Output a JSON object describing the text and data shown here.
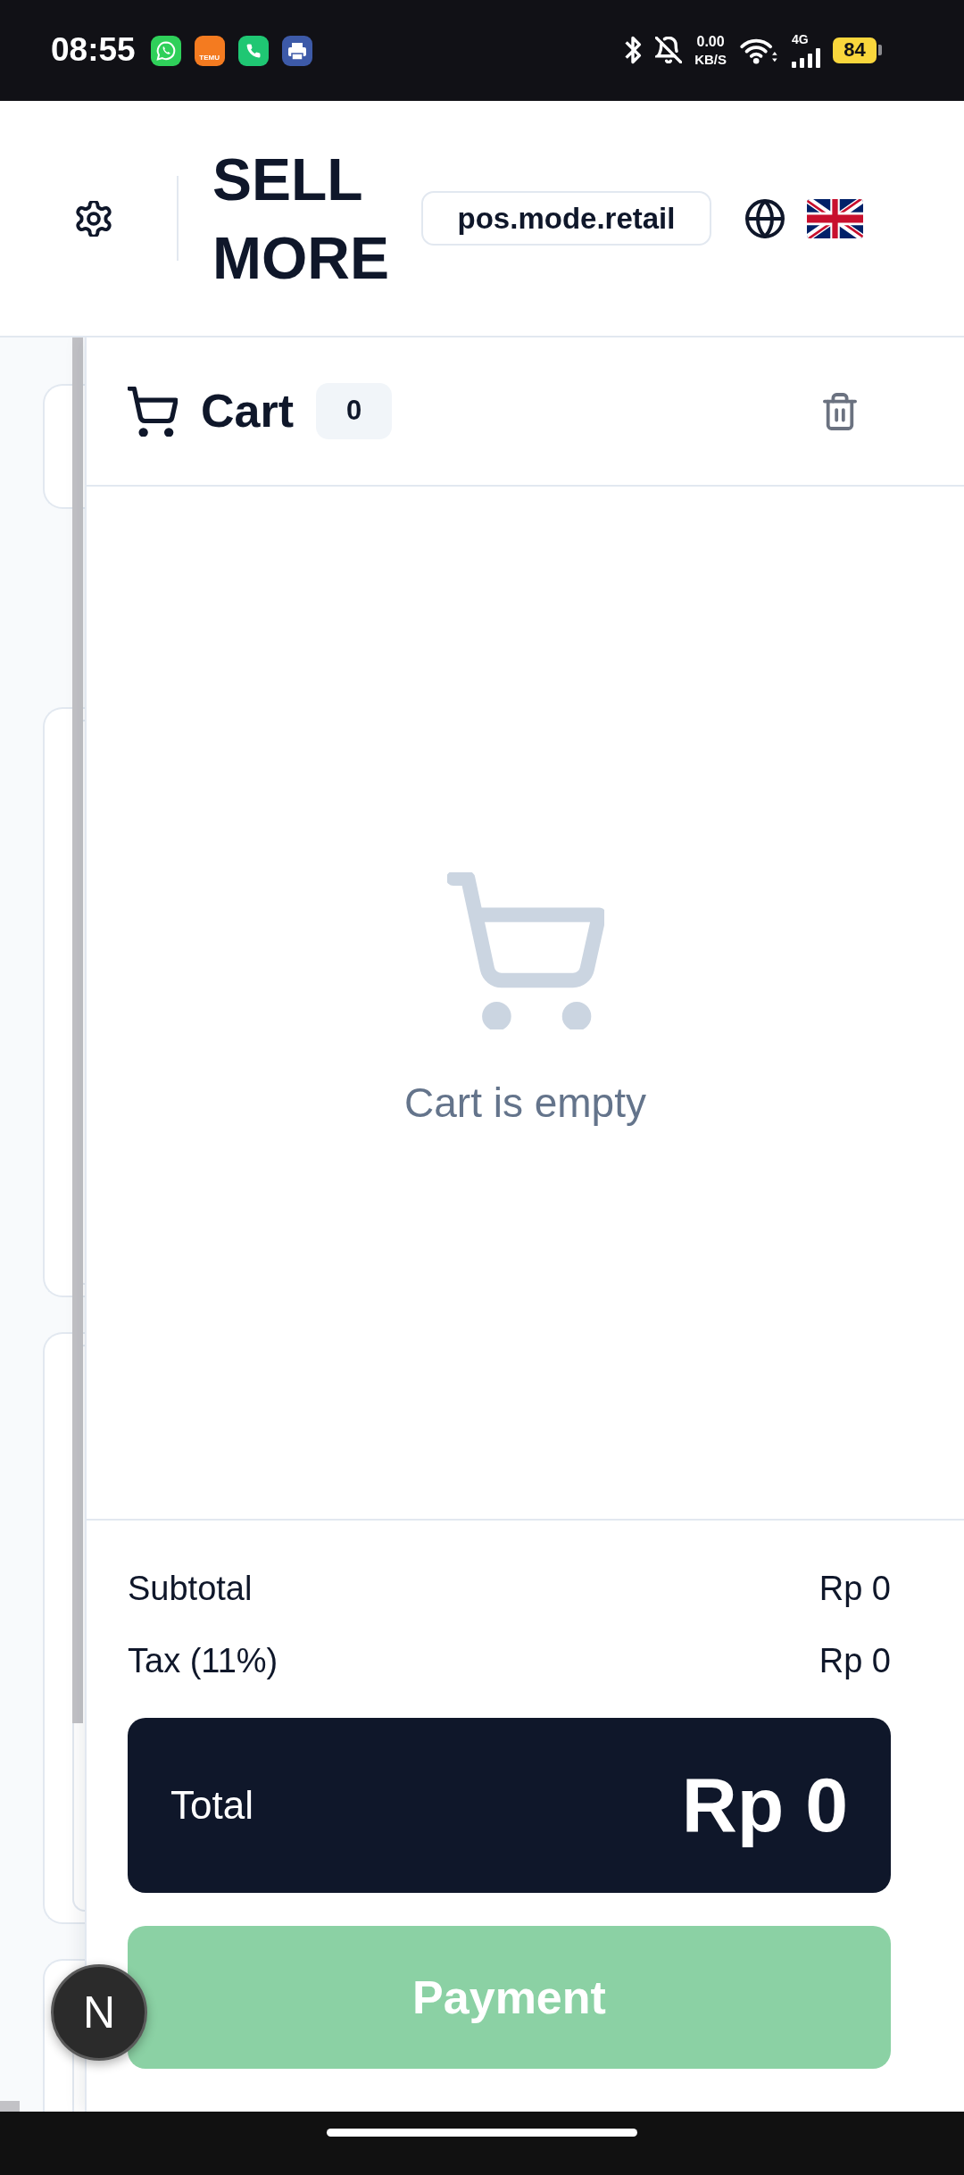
{
  "status_bar": {
    "time": "08:55",
    "notification_app_label": "TEMU",
    "data_speed": "0.00",
    "data_speed_unit": "KB/S",
    "network_type": "4G",
    "battery": "84"
  },
  "header": {
    "brand": "SELL MORE",
    "mode_badge": "pos.mode.retail"
  },
  "cart": {
    "title": "Cart",
    "count": "0",
    "empty_message": "Cart is empty",
    "summary": [
      {
        "label": "Subtotal",
        "value": "Rp 0"
      },
      {
        "label": "Tax (11%)",
        "value": "Rp 0"
      }
    ],
    "total": {
      "label": "Total",
      "value": "Rp 0"
    },
    "payment_button": {
      "label": "Payment",
      "disabled": true
    }
  },
  "dev_badge": {
    "label": "N"
  }
}
